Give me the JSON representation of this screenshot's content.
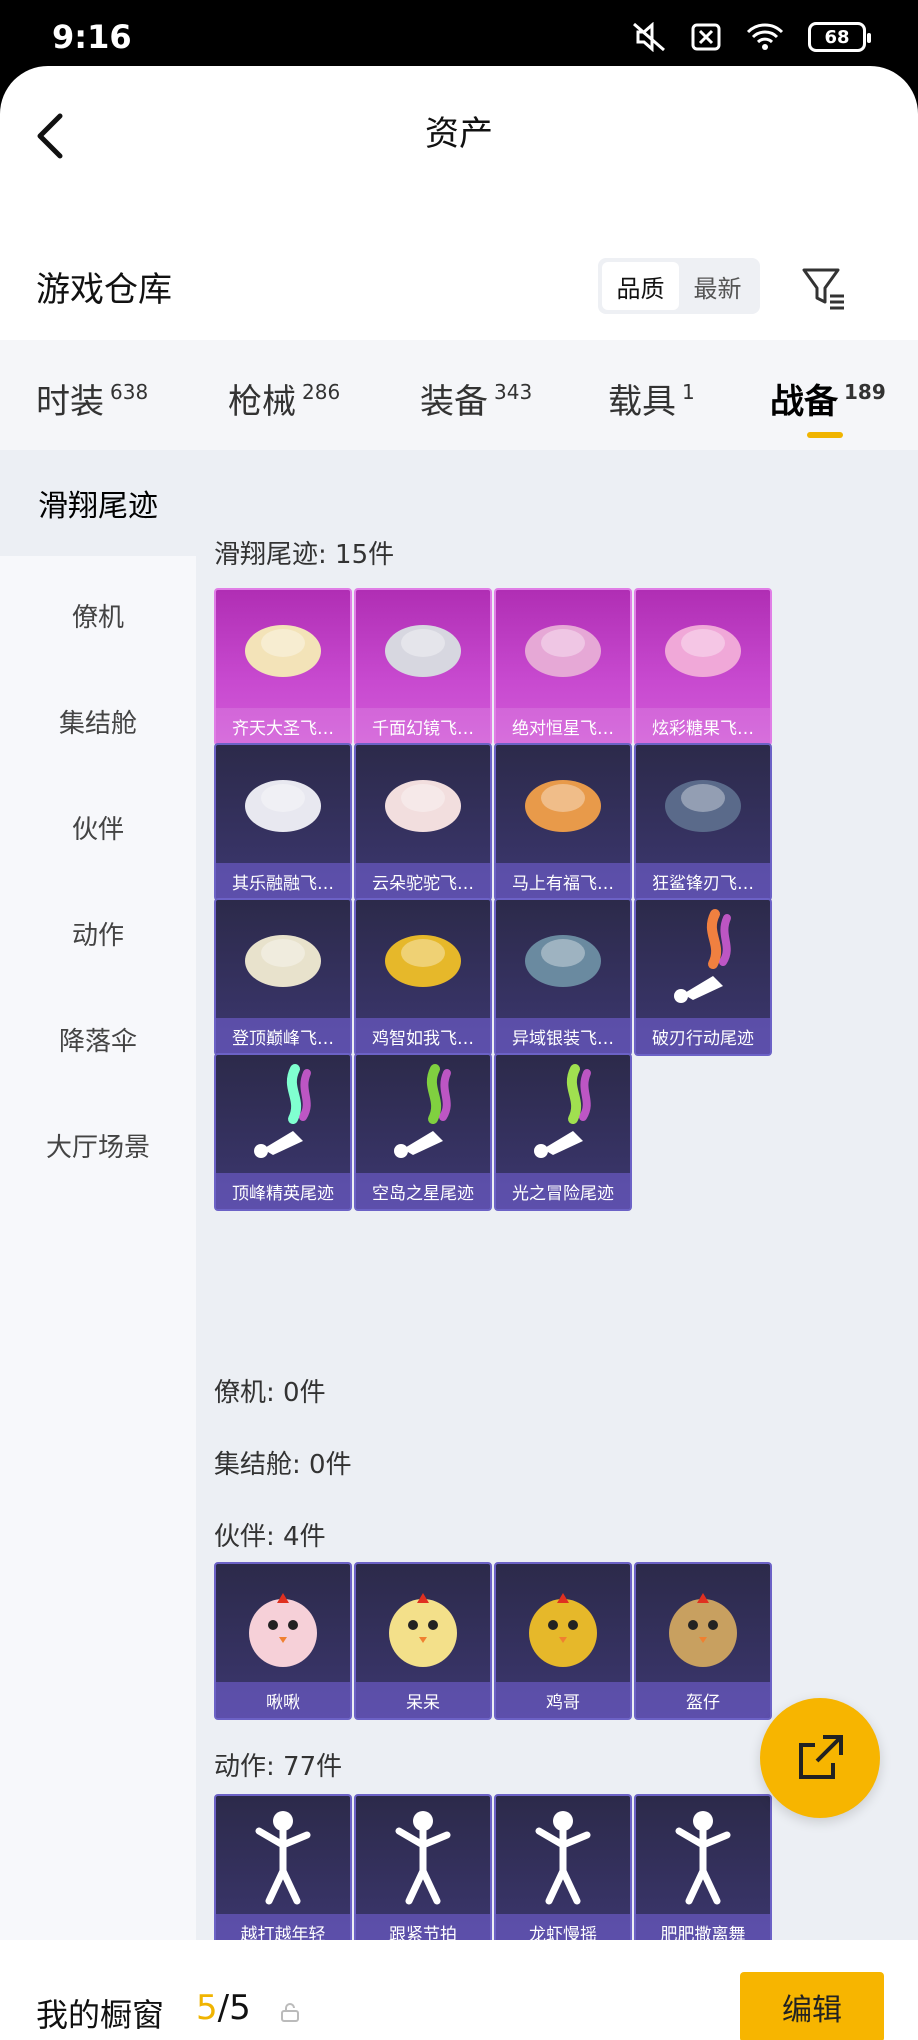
{
  "status": {
    "time": "9:16",
    "battery": "68"
  },
  "header": {
    "title": "资产"
  },
  "warehouse": {
    "title": "游戏仓库",
    "sort_quality": "品质",
    "sort_newest": "最新"
  },
  "tabs": [
    {
      "label": "时装",
      "count": "638"
    },
    {
      "label": "枪械",
      "count": "286"
    },
    {
      "label": "装备",
      "count": "343"
    },
    {
      "label": "载具",
      "count": "1"
    },
    {
      "label": "战备",
      "count": "189"
    }
  ],
  "sidebar": [
    "滑翔尾迹",
    "僚机",
    "集结舱",
    "伙伴",
    "动作",
    "降落伞",
    "大厅场景"
  ],
  "sections": {
    "glide": {
      "title": "滑翔尾迹: 15件",
      "items": [
        "齐天大圣飞…",
        "千面幻镜飞…",
        "绝对恒星飞…",
        "炫彩糖果飞…",
        "其乐融融飞…",
        "云朵驼驼飞…",
        "马上有福飞…",
        "狂鲨锋刃飞…",
        "登顶巅峰飞…",
        "鸡智如我飞…",
        "异域银装飞…",
        "破刃行动尾迹",
        "顶峰精英尾迹",
        "空岛之星尾迹",
        "光之冒险尾迹"
      ]
    },
    "wingman": {
      "title": "僚机: 0件"
    },
    "pod": {
      "title": "集结舱: 0件"
    },
    "partner": {
      "title": "伙伴: 4件",
      "items": [
        "啾啾",
        "呆呆",
        "鸡哥",
        "盔仔"
      ]
    },
    "emote": {
      "title": "动作: 77件",
      "items": [
        "越打越年轻",
        "跟紧节拍",
        "龙虾慢摇",
        "肥肥撒离舞"
      ]
    }
  },
  "bottom": {
    "showcase_label": "我的橱窗",
    "current": "5",
    "total": "/5",
    "edit": "编辑"
  },
  "colors": {
    "accent": "#f7b500",
    "card_purple": "#3c3770",
    "card_pink": "#c84ad0"
  }
}
